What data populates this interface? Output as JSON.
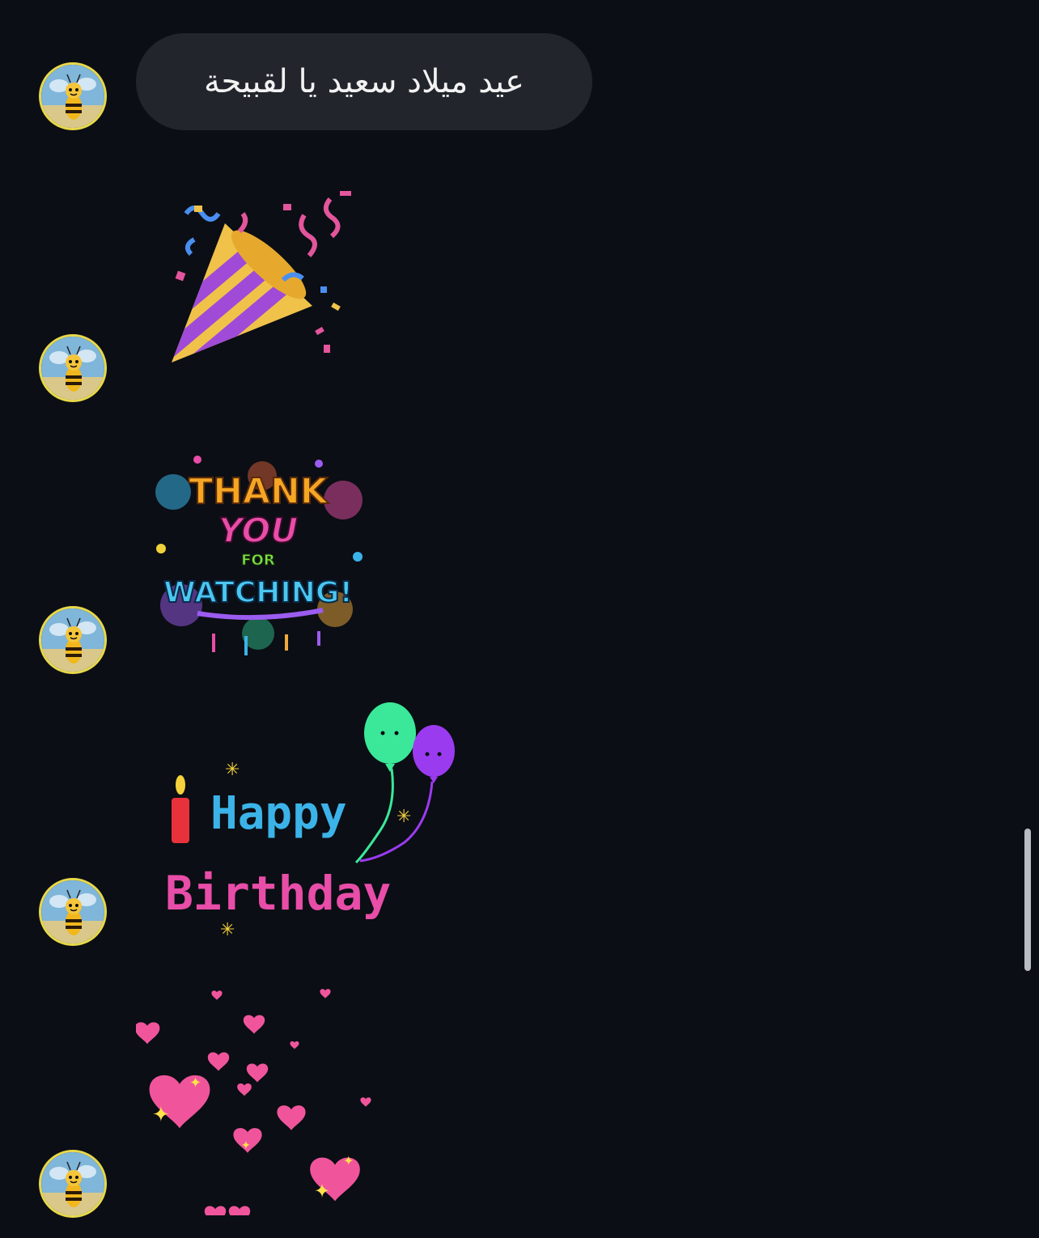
{
  "messages": [
    {
      "type": "text",
      "text": "عيد ميلاد سعيد يا لقبيحة"
    },
    {
      "type": "sticker",
      "sticker": "party-popper"
    },
    {
      "type": "sticker",
      "sticker": "thank-you-for-watching",
      "lines": [
        "THANK",
        "YOU",
        "FOR",
        "WATCHING!"
      ]
    },
    {
      "type": "sticker",
      "sticker": "happy-birthday-balloons",
      "lines": [
        "Happy",
        "Birthday"
      ]
    },
    {
      "type": "sticker",
      "sticker": "floating-hearts"
    }
  ],
  "avatar_icon": "bee-avatar-icon",
  "colors": {
    "background": "#0b0e14",
    "bubble": "#22252b",
    "text": "#f2f2f2"
  }
}
